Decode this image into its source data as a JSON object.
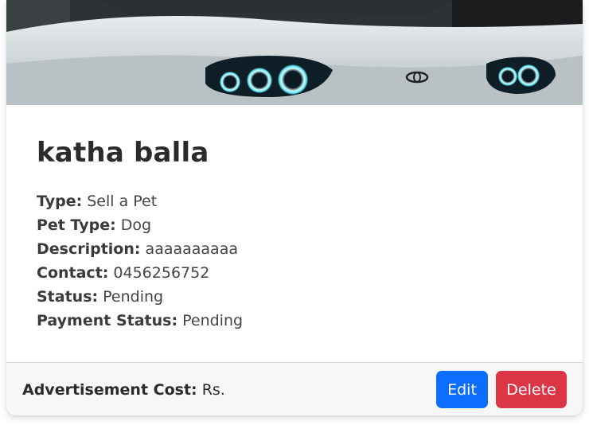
{
  "listing": {
    "image_alt": "white car with halo headlights",
    "title": "katha balla",
    "details": [
      {
        "label": "Type:",
        "value": "Sell a Pet"
      },
      {
        "label": "Pet Type:",
        "value": "Dog"
      },
      {
        "label": "Description:",
        "value": "aaaaaaaaaa"
      },
      {
        "label": "Contact:",
        "value": "0456256752"
      },
      {
        "label": "Status:",
        "value": "Pending"
      },
      {
        "label": "Payment Status:",
        "value": "Pending"
      }
    ]
  },
  "footer": {
    "cost_label": "Advertisement Cost:",
    "cost_value": "Rs.",
    "edit_label": "Edit",
    "delete_label": "Delete"
  },
  "colors": {
    "edit_button": "#0d6efd",
    "delete_button": "#dc3545",
    "footer_bg": "#f7f7f7"
  }
}
